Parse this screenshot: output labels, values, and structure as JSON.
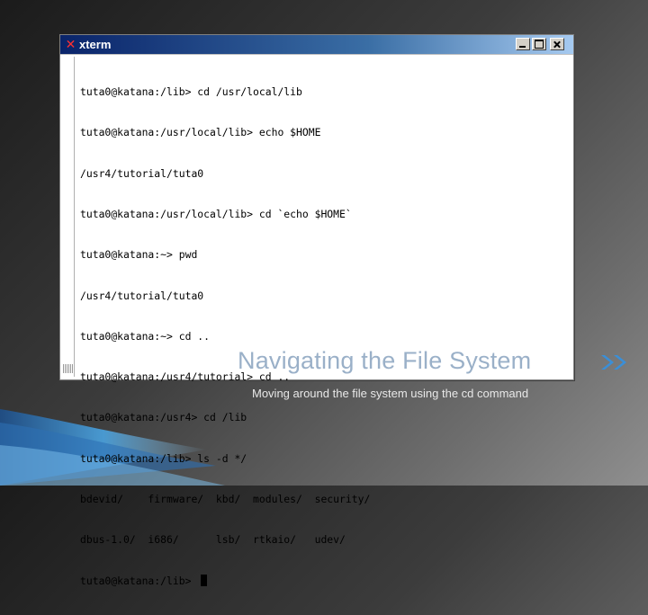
{
  "window": {
    "title": "xterm",
    "icon": "xterm-icon"
  },
  "terminal": {
    "lines": [
      "tuta0@katana:/lib> cd /usr/local/lib",
      "tuta0@katana:/usr/local/lib> echo $HOME",
      "/usr4/tutorial/tuta0",
      "tuta0@katana:/usr/local/lib> cd `echo $HOME`",
      "tuta0@katana:~> pwd",
      "/usr4/tutorial/tuta0",
      "tuta0@katana:~> cd ..",
      "tuta0@katana:/usr4/tutorial> cd ..",
      "tuta0@katana:/usr4> cd /lib",
      "tuta0@katana:/lib> ls -d */",
      "bdevid/    firmware/  kbd/  modules/  security/",
      "dbus-1.0/  i686/      lsb/  rtkaio/   udev/",
      "tuta0@katana:/lib> "
    ]
  },
  "slide": {
    "title": "Navigating the File System",
    "subtitle": "Moving around the file system using the cd command",
    "title_color": "#9ab0c8",
    "accent_color": "#3a8fd8"
  }
}
